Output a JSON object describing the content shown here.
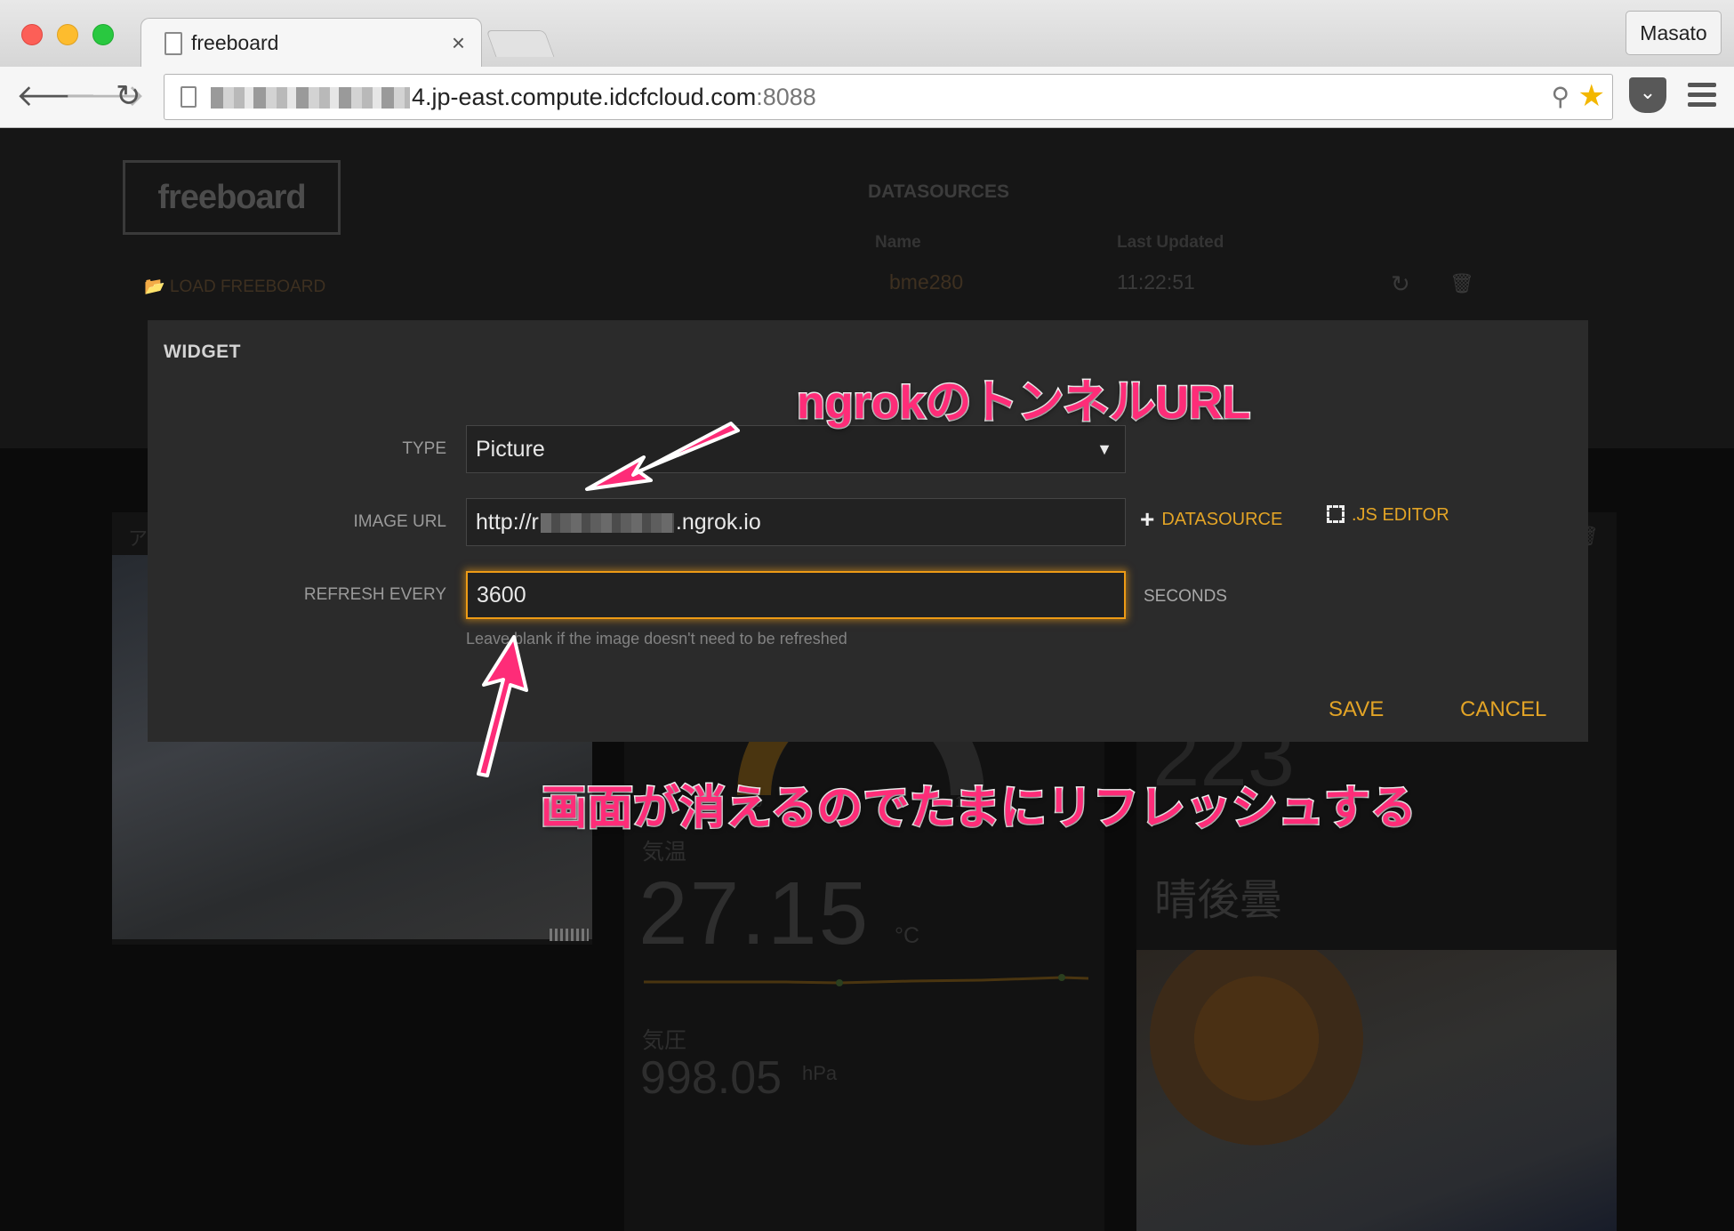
{
  "browser": {
    "tab_title": "freeboard",
    "tab_close": "×",
    "profile_name": "Masato",
    "url_visible": ".jp-east.compute.idcfcloud.com",
    "url_port": ":8088",
    "url_prefix_glyph": "4"
  },
  "header": {
    "logo": "freeboard",
    "load_link": "LOAD FREEBOARD",
    "datasources_title": "DATASOURCES",
    "col_name": "Name",
    "col_updated": "Last Updated",
    "datasource_name": "bme280",
    "datasource_updated": "11:22:51"
  },
  "panes": {
    "left_letter": "ア",
    "gauge_min": "0",
    "gauge_max": "100",
    "temp_label": "気温",
    "temp_value": "27.15",
    "temp_unit": "°C",
    "pressure_label": "気圧",
    "pressure_value": "998.05",
    "pressure_unit": "hPa",
    "right_big": "223",
    "weather_text": "晴後曇"
  },
  "modal": {
    "title": "WIDGET",
    "type_label": "TYPE",
    "type_value": "Picture",
    "url_label": "IMAGE URL",
    "url_prefix": "http://r",
    "url_suffix": ".ngrok.io",
    "datasource_link": "DATASOURCE",
    "js_editor_link": ".JS EDITOR",
    "refresh_label": "REFRESH EVERY",
    "refresh_value": "3600",
    "seconds_label": "SECONDS",
    "hint": "Leave blank if the image doesn't need to be refreshed",
    "save_label": "SAVE",
    "cancel_label": "CANCEL"
  },
  "annotations": {
    "top": "ngrokのトンネルURL",
    "bottom": "画面が消えるのでたまにリフレッシュする",
    "color": "#fe2c78"
  },
  "colors": {
    "accent": "#e3a426",
    "focus_border": "#ee9b15"
  }
}
